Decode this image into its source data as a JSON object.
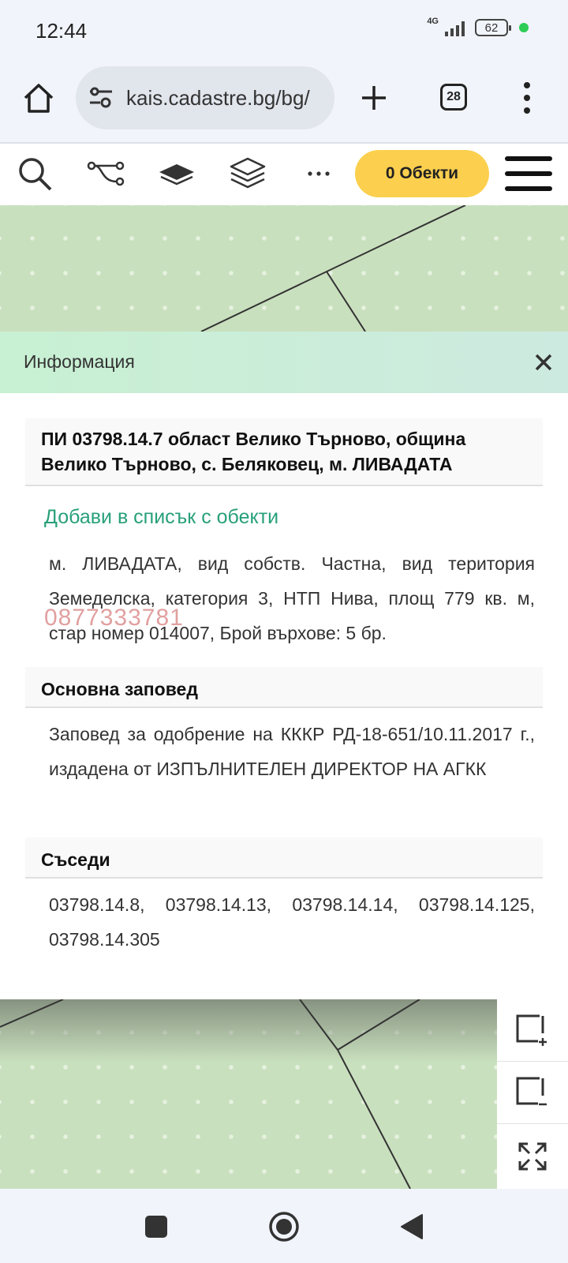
{
  "status": {
    "time": "12:44",
    "network": "4G",
    "battery": "62"
  },
  "browser": {
    "url": "kais.cadastre.bg/bg/",
    "tab_count": "28"
  },
  "toolbar": {
    "objects_label": "0 Обекти"
  },
  "info": {
    "header_title": "Информация",
    "parcel_title": "ПИ 03798.14.7 област Велико Търново, община Велико Търново, с. Беляковец, м. ЛИВАДАТА",
    "add_link": "Добави в списък с обекти",
    "watermark_phone": "0877333781",
    "parcel_details": "м. ЛИВАДАТА, вид собств. Частна, вид територия Земеделска, категория 3, НТП Нива, площ 779 кв. м, стар номер 014007, Брой върхове: 5 бр.",
    "order_heading": "Основна заповед",
    "order_text": "Заповед за одобрение на КККР РД-18-651/10.11.2017 г., издадена от ИЗПЪЛНИТЕЛЕН ДИРЕКТОР НА АГКК",
    "neighbors_heading": "Съседи",
    "neighbors_text": "03798.14.8, 03798.14.13, 03798.14.14, 03798.14.125, 03798.14.305"
  },
  "colors": {
    "accent_yellow": "#fcd04e",
    "link_green": "#28a07a",
    "map_green": "#c9e0be"
  }
}
